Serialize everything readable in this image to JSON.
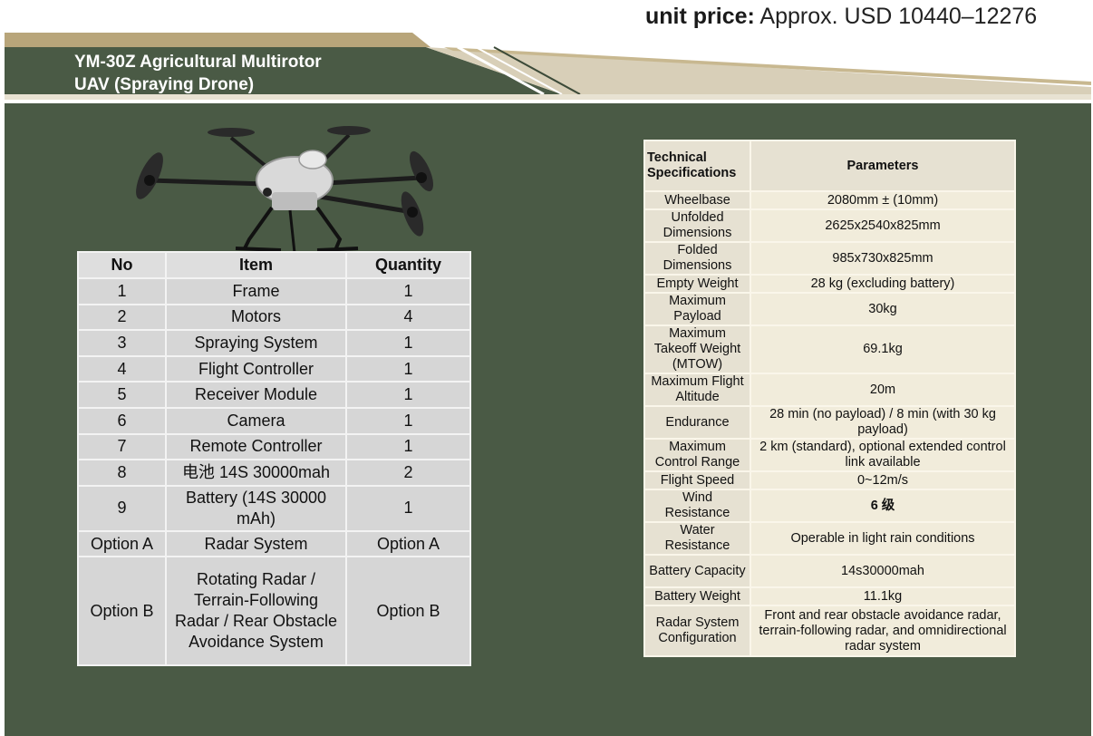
{
  "header": {
    "title_line1": "YM-30Z Agricultural Multirotor",
    "title_line2": "UAV (Spraying Drone)",
    "price_label": "unit price:",
    "price_value": " Approx. USD 10440–12276"
  },
  "colors": {
    "panel": "#4a5a45",
    "header_band": "#4a5a45",
    "header_accent": "#a8956a",
    "table_cell": "#d6d6d6",
    "spec_cell": "#f1ecdb"
  },
  "drone_image": {
    "icon": "spraying-drone-icon"
  },
  "parts_table": {
    "headers": [
      "No",
      "Item",
      "Quantity"
    ],
    "rows": [
      [
        "1",
        "Frame",
        "1"
      ],
      [
        "2",
        "Motors",
        "4"
      ],
      [
        "3",
        "Spraying System",
        "1"
      ],
      [
        "4",
        "Flight Controller",
        "1"
      ],
      [
        "5",
        "Receiver Module",
        "1"
      ],
      [
        "6",
        "Camera",
        "1"
      ],
      [
        "7",
        "Remote Controller",
        "1"
      ],
      [
        "8",
        "电池 14S 30000mah",
        "2"
      ],
      [
        "9",
        "Battery (14S 30000 mAh)",
        "1"
      ],
      [
        "Option A",
        "Radar System",
        "Option A"
      ],
      [
        "Option B",
        "Rotating Radar / Terrain-Following Radar / Rear Obstacle Avoidance System",
        "Option B"
      ]
    ]
  },
  "spec_table": {
    "headers": [
      "Technical Specifications",
      "Parameters"
    ],
    "rows": [
      [
        "Wheelbase",
        "2080mm ± (10mm)"
      ],
      [
        "Unfolded Dimensions",
        "2625x2540x825mm"
      ],
      [
        "Folded Dimensions",
        "985x730x825mm"
      ],
      [
        "Empty Weight",
        "28 kg (excluding battery)"
      ],
      [
        "Maximum Payload",
        "30kg"
      ],
      [
        "Maximum Takeoff Weight (MTOW)",
        "69.1kg"
      ],
      [
        "Maximum Flight Altitude",
        "20m"
      ],
      [
        "Endurance",
        "28 min (no payload) / 8 min (with 30 kg payload)"
      ],
      [
        "Maximum Control Range",
        "2 km (standard), optional extended control link available"
      ],
      [
        "Flight Speed",
        "0~12m/s"
      ],
      [
        "Wind Resistance",
        "6 级"
      ],
      [
        "Water Resistance",
        "Operable in light rain conditions"
      ],
      [
        "Battery Capacity",
        "14s30000mah"
      ],
      [
        "Battery Weight",
        "11.1kg"
      ],
      [
        "Radar System Configuration",
        "Front and rear obstacle avoidance radar, terrain-following radar, and omnidirectional radar system"
      ]
    ]
  }
}
